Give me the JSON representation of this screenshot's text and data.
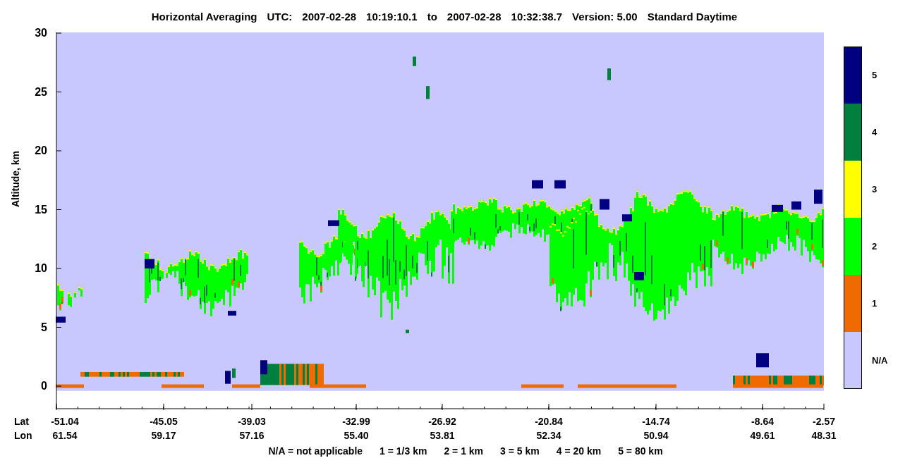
{
  "title": [
    "Horizontal Averaging",
    "UTC:",
    "2007-02-28",
    "10:19:10.1",
    "to",
    "2007-02-28",
    "10:32:38.7",
    "Version: 5.00",
    "Standard Daytime"
  ],
  "y_axis": {
    "label": "Altitude, km",
    "ticks": [
      "30",
      "25",
      "20",
      "15",
      "10",
      "5",
      "0"
    ]
  },
  "x_axis": {
    "row_labels": [
      "Lat",
      "Lon"
    ],
    "ticks": [
      {
        "lat": "-51.04",
        "lon": "61.54"
      },
      {
        "lat": "-45.05",
        "lon": "59.17"
      },
      {
        "lat": "-39.03",
        "lon": "57.16"
      },
      {
        "lat": "-32.99",
        "lon": "55.40"
      },
      {
        "lat": "-26.92",
        "lon": "53.81"
      },
      {
        "lat": "-20.84",
        "lon": "52.34"
      },
      {
        "lat": "-14.74",
        "lon": "50.94"
      },
      {
        "lat": "-8.64",
        "lon": "49.61"
      },
      {
        "lat": "-2.57",
        "lon": "48.31"
      }
    ]
  },
  "legend": {
    "items": [
      {
        "label": "5",
        "color": "#000080"
      },
      {
        "label": "4",
        "color": "#007f3f"
      },
      {
        "label": "3",
        "color": "#ffff00"
      },
      {
        "label": "2",
        "color": "#00ff00"
      },
      {
        "label": "1",
        "color": "#ef6a00"
      },
      {
        "label": "N/A",
        "color": "#c8c8ff"
      }
    ]
  },
  "footnote": [
    "N/A = not applicable",
    "1 = 1/3 km",
    "2 = 1 km",
    "3 = 5 km",
    "4 = 20 km",
    "5 = 80 km"
  ]
}
